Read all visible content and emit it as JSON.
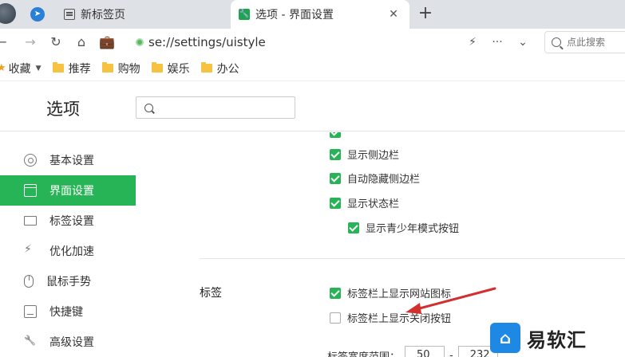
{
  "tabs": [
    {
      "title": "新标签页",
      "active": false,
      "icon": "newtab-icon"
    },
    {
      "title": "选项 - 界面设置",
      "active": true,
      "icon": "settings-icon"
    }
  ],
  "toolbar": {
    "url": "se://settings/uistyle",
    "search_placeholder": "点此搜索"
  },
  "bookmarks": {
    "items": [
      "收藏",
      "推荐",
      "购物",
      "娱乐",
      "办公"
    ]
  },
  "settings": {
    "title": "选项",
    "search_value": ""
  },
  "sidebar": {
    "items": [
      {
        "label": "基本设置",
        "icon": "basic-settings-icon",
        "active": false
      },
      {
        "label": "界面设置",
        "icon": "interface-icon",
        "active": true
      },
      {
        "label": "标签设置",
        "icon": "tab-settings-icon",
        "active": false
      },
      {
        "label": "优化加速",
        "icon": "speed-icon",
        "active": false
      },
      {
        "label": "鼠标手势",
        "icon": "mouse-icon",
        "active": false
      },
      {
        "label": "快捷键",
        "icon": "keyboard-icon",
        "active": false
      },
      {
        "label": "高级设置",
        "icon": "advanced-icon",
        "active": false
      }
    ]
  },
  "content": {
    "options": [
      {
        "label": "显示侧边栏",
        "checked": true
      },
      {
        "label": "自动隐藏侧边栏",
        "checked": true
      },
      {
        "label": "显示状态栏",
        "checked": true
      },
      {
        "label": "显示青少年模式按钮",
        "checked": true
      }
    ],
    "tab_section": {
      "label": "标签",
      "options": [
        {
          "label": "标签栏上显示网站图标",
          "checked": true
        },
        {
          "label": "标签栏上显示关闭按钮",
          "checked": false
        }
      ],
      "width_label": "标签宽度范围：",
      "width_min": "50",
      "width_sep": "-",
      "width_max": "232"
    }
  },
  "watermark": {
    "text": "易软汇",
    "logo": "logo"
  },
  "colors": {
    "accent": "#27b456",
    "arrow": "#d32f2f"
  }
}
